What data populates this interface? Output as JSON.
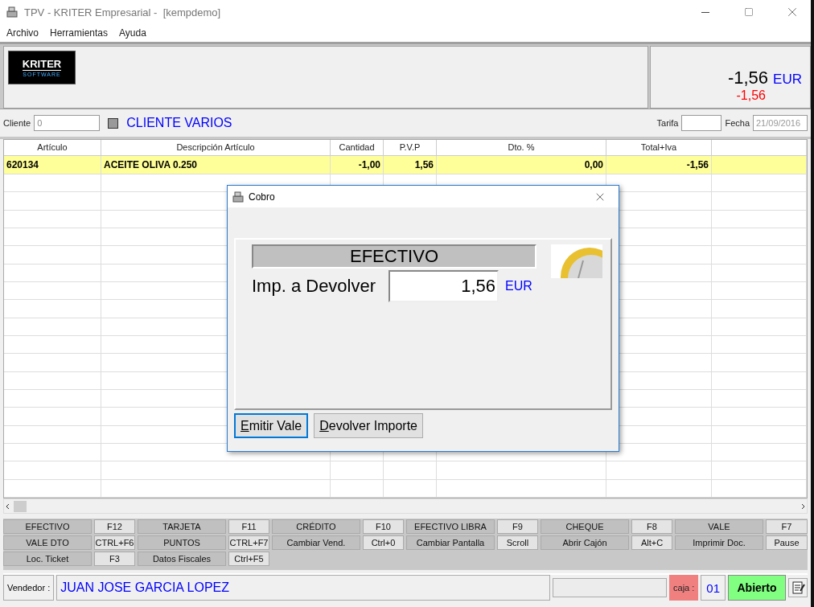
{
  "window": {
    "title": "TPV - KRITER Empresarial -  [kempdemo]"
  },
  "menu": [
    "Archivo",
    "Herramientas",
    "Ayuda"
  ],
  "logo": {
    "line1": "KRITER",
    "line2": "SOFTWARE"
  },
  "totals": {
    "amount": "-1,56",
    "currency": "EUR",
    "pending": "-1,56"
  },
  "client": {
    "label": "Cliente",
    "value": "0",
    "checked": false,
    "name": "CLIENTE VARIOS",
    "tarifa_label": "Tarifa",
    "fecha_label": "Fecha",
    "fecha_value": "21/09/2016"
  },
  "table": {
    "columns": [
      "Artículo",
      "Descripción Artículo",
      "Cantidad",
      "P.V.P",
      "Dto. %",
      "Total+Iva"
    ],
    "rows": [
      {
        "selected": true,
        "cells": [
          "620134",
          "ACEITE OLIVA 0.250",
          "-1,00",
          "1,56",
          "0,00",
          "-1,56"
        ]
      }
    ]
  },
  "function_keys": [
    {
      "label": "EFECTIVO",
      "key": "F12"
    },
    {
      "label": "TARJETA",
      "key": "F11"
    },
    {
      "label": "CRÉDITO",
      "key": "F10"
    },
    {
      "label": "EFECTIVO LIBRA",
      "key": "F9"
    },
    {
      "label": "CHEQUE",
      "key": "F8"
    },
    {
      "label": "VALE",
      "key": "F7"
    },
    {
      "label": "VALE DTO",
      "key": "CTRL+F6"
    },
    {
      "label": "PUNTOS",
      "key": "CTRL+F7"
    },
    {
      "label": "Cambiar Vend.",
      "key": "Ctrl+0"
    },
    {
      "label": "Cambiar Pantalla",
      "key": "Scroll"
    },
    {
      "label": "Abrir Cajón",
      "key": "Alt+C"
    },
    {
      "label": "Imprimir Doc.",
      "key": "Pause"
    },
    {
      "label": "Loc. Ticket",
      "key": "F3"
    },
    {
      "label": "Datos Fiscales",
      "key": "Ctrl+F5"
    }
  ],
  "status": {
    "vendor_label": "Vendedor :",
    "vendor": "JUAN JOSE GARCIA LOPEZ",
    "caja_label": "caja :",
    "caja": "01",
    "state": "Abierto"
  },
  "dialog": {
    "title": "Cobro",
    "method": "EFECTIVO",
    "label": "Imp. a Devolver",
    "value": "1,56",
    "currency": "EUR",
    "buttons": [
      {
        "label": "Emitir Vale",
        "selected": true
      },
      {
        "label": "Devolver Importe",
        "selected": false
      }
    ]
  }
}
